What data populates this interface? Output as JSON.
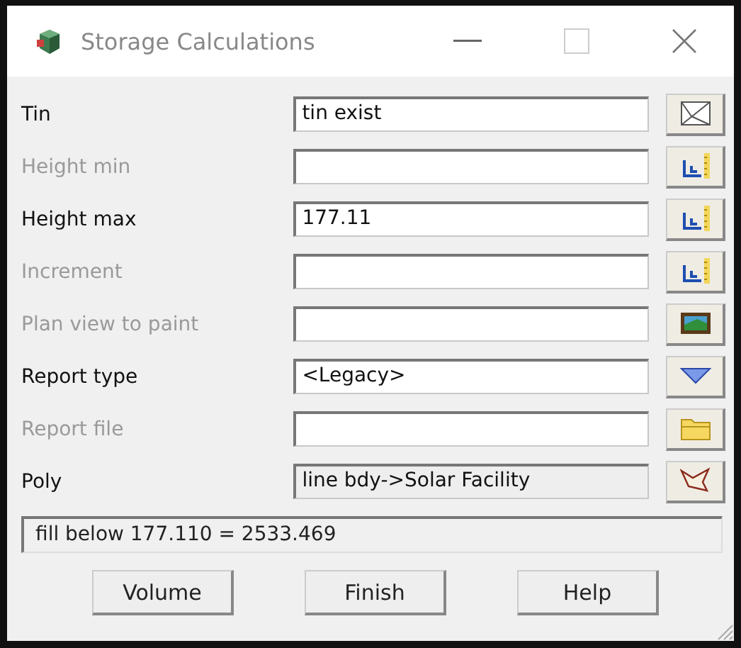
{
  "window": {
    "title": "Storage Calculations"
  },
  "rows": [
    {
      "label": "Tin",
      "disabled": false,
      "value": "tin exist",
      "readonly": false,
      "kind": "tin"
    },
    {
      "label": "Height min",
      "disabled": true,
      "readonly": false,
      "kind": "height"
    },
    {
      "label": "Height max",
      "disabled": false,
      "value": "177.11",
      "readonly": false,
      "kind": "height"
    },
    {
      "label": "Increment",
      "disabled": true,
      "readonly": false,
      "kind": "height"
    },
    {
      "label": "Plan view to paint",
      "disabled": true,
      "readonly": false,
      "kind": "view"
    },
    {
      "label": "Report type",
      "disabled": false,
      "value": "<Legacy>",
      "readonly": false,
      "kind": "dropdown"
    },
    {
      "label": "Report file",
      "disabled": true,
      "readonly": false,
      "kind": "folder"
    },
    {
      "label": "Poly",
      "disabled": false,
      "value": "line bdy->Solar Facility",
      "readonly": true,
      "kind": "poly"
    }
  ],
  "status_bar": "fill below 177.110 = 2533.469",
  "buttons": [
    "Volume",
    "Finish",
    "Help"
  ]
}
